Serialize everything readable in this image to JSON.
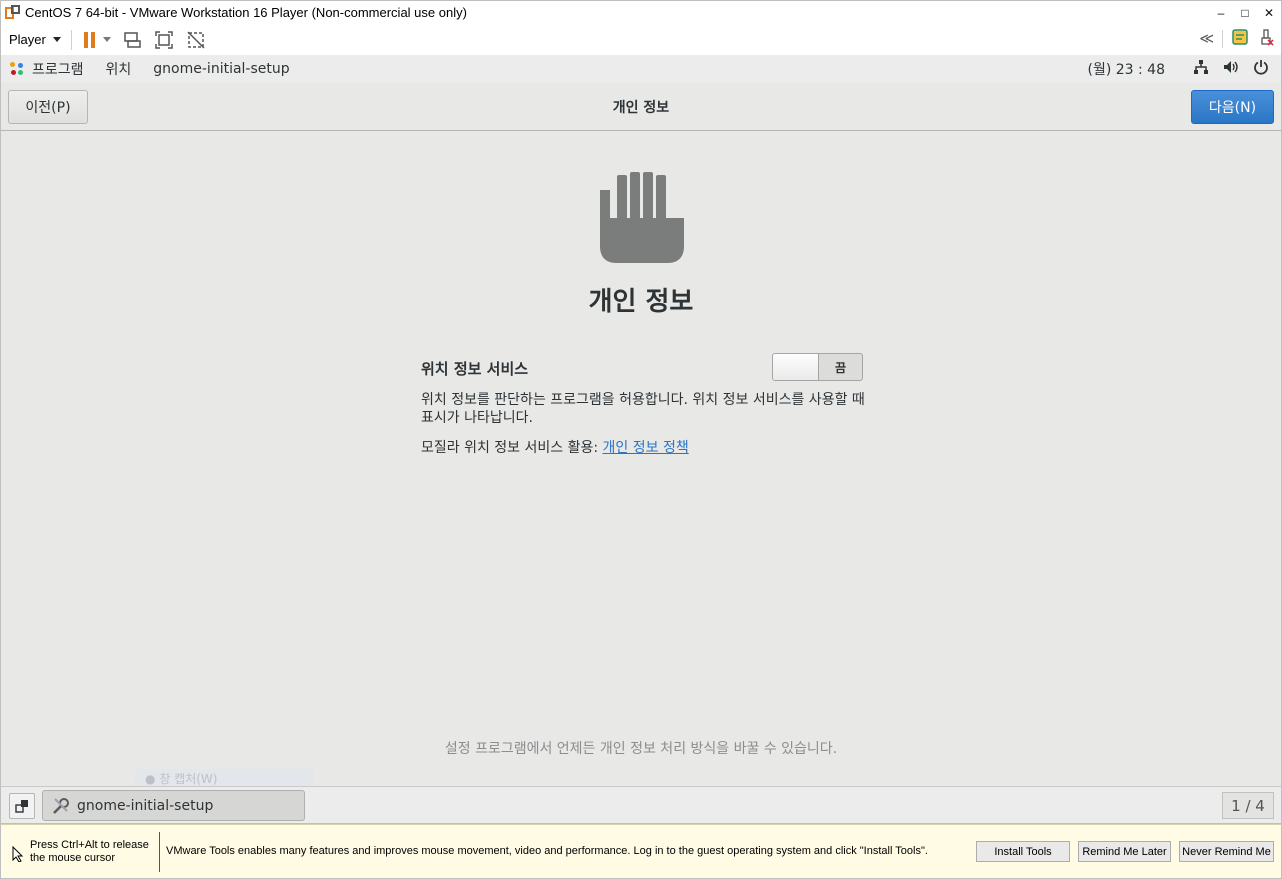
{
  "window": {
    "title": "CentOS 7 64-bit - VMware Workstation 16 Player (Non-commercial use only)",
    "minimize_glyph": "–",
    "maximize_glyph": "□",
    "close_glyph": "✕"
  },
  "vm_toolbar": {
    "player_label": "Player",
    "unity_glyph": "≪"
  },
  "gnome_panel": {
    "applications": "프로그램",
    "places": "위치",
    "active_app": "gnome-initial-setup",
    "clock": "(월) 23 : 48"
  },
  "setup_header": {
    "prev_label": "이전(P)",
    "title": "개인 정보",
    "next_label": "다음(N)"
  },
  "content": {
    "heading": "개인 정보",
    "location_label": "위치 정보 서비스",
    "switch_state": "끔",
    "switch_on": false,
    "description": "위치 정보를 판단하는 프로그램을 허용합니다. 위치 정보 서비스를 사용할 때 표시가 나타납니다.",
    "mozilla_prefix": "모질라 위치 정보 서비스 활용: ",
    "policy_link": "개인 정보 정책",
    "footnote": "설정 프로그램에서 언제든 개인 정보 처리 방식을 바꿀 수 있습니다.",
    "ghost_menu_item": "창 캡처(W)"
  },
  "taskbar": {
    "task_label": "gnome-initial-setup",
    "workspace": "1 / 4"
  },
  "hint_bar": {
    "release_text": "Press Ctrl+Alt to release the mouse cursor",
    "message": "VMware Tools enables many features and improves mouse movement, video and performance. Log in to the guest operating system and click \"Install Tools\".",
    "install_button": "Install Tools",
    "remind_button": "Remind Me Later",
    "never_button": "Never Remind Me"
  },
  "colors": {
    "accent": "#2a76c6",
    "vm_orange": "#e07b1d",
    "background": "#e8e8e7"
  }
}
